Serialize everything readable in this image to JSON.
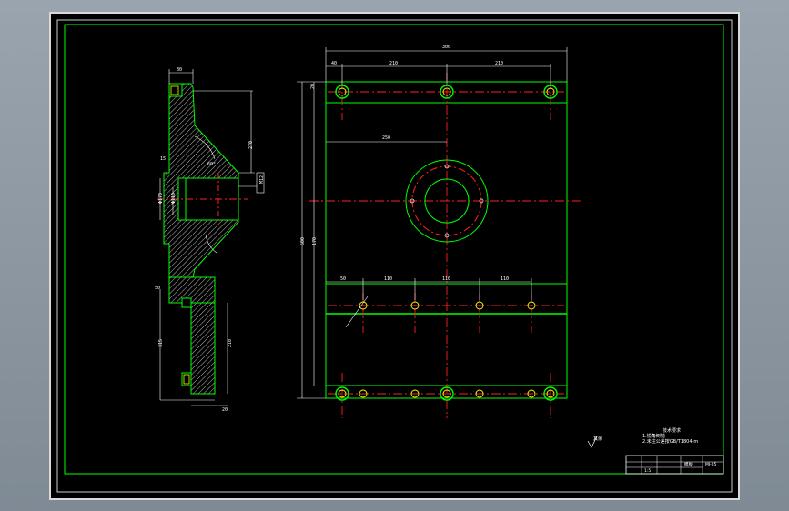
{
  "colors": {
    "background": "#000000",
    "frame": "#d9d9d9",
    "border": "#00ff00",
    "geometry": "#00ff00",
    "centerline": "#ff2020",
    "dimension": "#ffffff",
    "hatch": "#b8b8b8",
    "bolt": "#ffff00"
  },
  "side_view": {
    "dims": {
      "top_width": "30",
      "height_top": "270",
      "bore_small": "Φ110",
      "bore_large": "Φ170",
      "gap": "15",
      "flange": "50",
      "lower_height": "315",
      "lower_inner": "210",
      "base": "20",
      "angle": "60°",
      "hole": "M12"
    }
  },
  "front_view": {
    "dims": {
      "overall_width": "300",
      "offset_left": "40",
      "span_1": "210",
      "span_2": "210",
      "center_offset": "250",
      "overall_height": "500",
      "height_inner": "170",
      "top_margin": "20",
      "row_left": "50",
      "pitch_1": "110",
      "pitch_2": "110",
      "pitch_3": "110"
    }
  },
  "notes": {
    "roughness": "其余",
    "title": "技术要求",
    "line1": "1.锐角倒钝",
    "line2": "2.未注公差按GB/T1804-m"
  },
  "title_block": {
    "part_name": "模板",
    "scale": "1:5",
    "drawing_no": "MJ-05"
  }
}
